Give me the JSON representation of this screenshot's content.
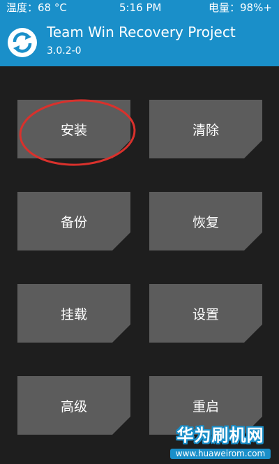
{
  "status_bar": {
    "temperature": "温度：68 °C",
    "time": "5:16 PM",
    "battery": "电量：98%+"
  },
  "header": {
    "title": "Team Win Recovery Project",
    "version": "3.0.2-0",
    "logo_icon": "twrp-logo-icon"
  },
  "menu": {
    "install": "安装",
    "wipe": "清除",
    "backup": "备份",
    "restore": "恢复",
    "mount": "挂载",
    "settings": "设置",
    "advanced": "高级",
    "reboot": "重启"
  },
  "watermark": {
    "text": "华为刷机网",
    "url": "www.huaweirom.com"
  },
  "colors": {
    "accent": "#1a8fc9",
    "button": "#5c5c5c",
    "background": "#1e1e1e",
    "annotation": "#d9312c"
  }
}
